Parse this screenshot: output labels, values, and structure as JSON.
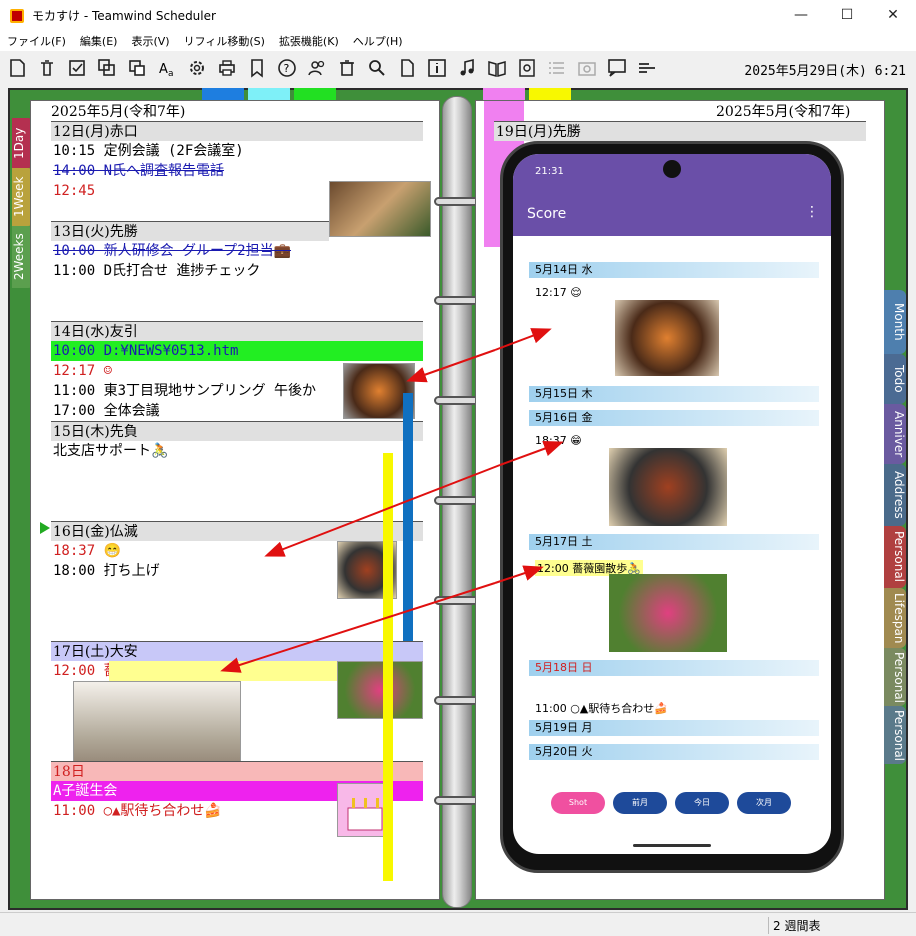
{
  "window": {
    "title": "モカすけ - Teamwind Scheduler",
    "minimize": "—",
    "maximize": "☐",
    "close": "✕"
  },
  "menu": [
    "ファイル(F)",
    "編集(E)",
    "表示(V)",
    "リフィル移動(S)",
    "拡張機能(K)",
    "ヘルプ(H)"
  ],
  "toolbar_icons": [
    "new-icon",
    "delete-icon",
    "check-icon",
    "copy-icon",
    "paste-icon",
    "font-icon",
    "settings-icon",
    "print-icon",
    "bookmark-icon",
    "help-icon",
    "users-icon",
    "trash-icon",
    "search-icon",
    "document-icon",
    "info-icon",
    "music-icon",
    "book-icon",
    "import-icon",
    "list-icon",
    "camera-icon",
    "comment-icon",
    "menu-icon"
  ],
  "clock": "2025年5月29日(木) 6:21",
  "left_tabs": [
    "1Day",
    "1Week",
    "2Weeks"
  ],
  "right_tabs": [
    "Month",
    "Todo",
    "Anniver",
    "Address",
    "Personal",
    "Lifespan",
    "Personal",
    "Personal"
  ],
  "left_page": {
    "header": "2025年5月(令和7年)",
    "days": [
      {
        "label": "12日(月)赤口",
        "events": [
          "10:15 定例会議 (2F会議室)",
          "14:00 N氏へ調査報告電話",
          "12:45"
        ]
      },
      {
        "label": "13日(火)先勝",
        "events": [
          "10:00 新人研修会 グループ2担当💼",
          "11:00 D氏打合せ 進捗チェック"
        ]
      },
      {
        "label": "14日(水)友引",
        "events": [
          "10:00 D:¥NEWS¥0513.htm",
          "12:17 ☺",
          "11:00 東3丁目現地サンプリング 午後か",
          "17:00 全体会議"
        ]
      },
      {
        "label": "15日(木)先負",
        "events": [
          "北支店サポート🚴"
        ]
      },
      {
        "label": "16日(金)仏滅",
        "events": [
          "18:37 😁",
          "18:00 打ち上げ"
        ]
      },
      {
        "label": "17日(土)大安",
        "events": [
          "12:00 薔薇園散歩🚴"
        ]
      },
      {
        "label": "18日",
        "events": [
          "A子誕生会",
          "11:00 ○▲駅待ち合わせ🍰"
        ]
      }
    ]
  },
  "right_page": {
    "header": "2025年5月(令和7年)",
    "first_day": "19日(月)先勝"
  },
  "phone": {
    "status_time": "21:31",
    "app_title": "Score",
    "entries": [
      {
        "day": "5月14日 水",
        "time": "12:17 😌"
      },
      {
        "day": "5月15日 木"
      },
      {
        "day": "5月16日 金",
        "time": "18:37 😁"
      },
      {
        "day": "5月17日 土",
        "time": "12:00 薔薇園散歩🚴"
      },
      {
        "day": "5月18日 日",
        "time": "11:00 ○▲駅待ち合わせ🍰"
      },
      {
        "day": "5月19日 月"
      },
      {
        "day": "5月20日 火"
      }
    ],
    "buttons": [
      "Shot",
      "前月",
      "今日",
      "次月"
    ]
  },
  "status": "2 週間表",
  "colors": {
    "binder": "#3f8f3a",
    "appbar": "#6a4fa8",
    "arrow": "#e01010"
  }
}
